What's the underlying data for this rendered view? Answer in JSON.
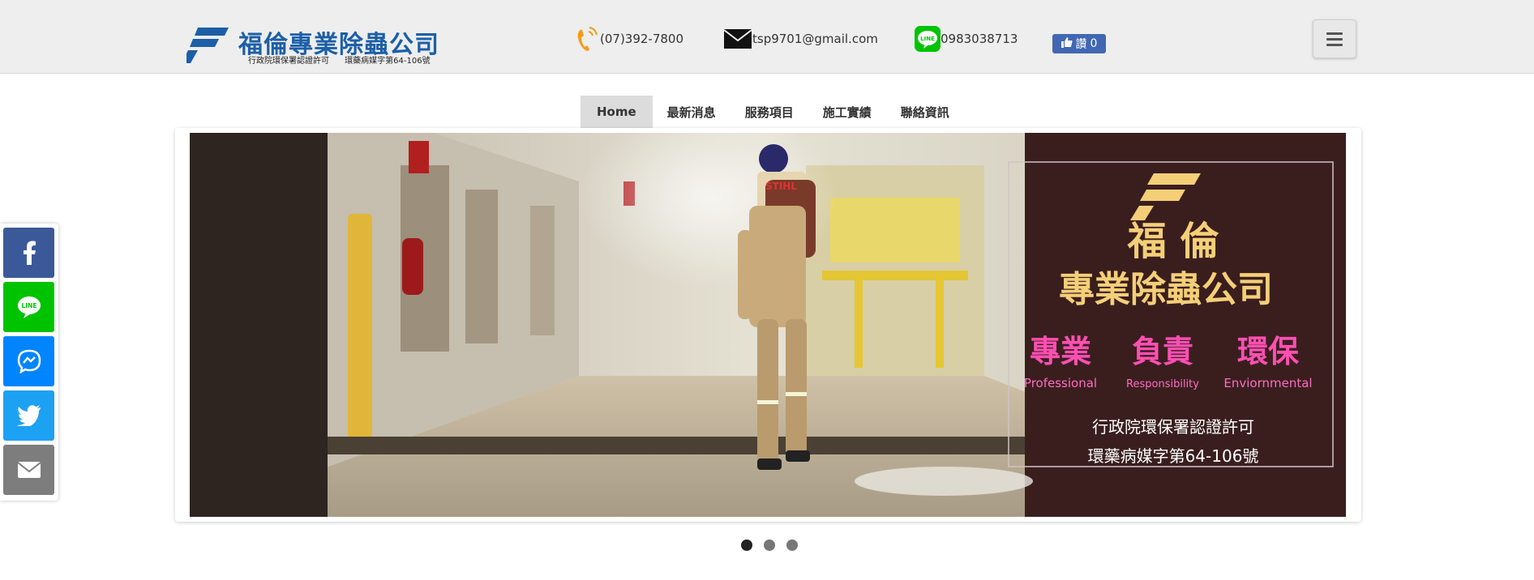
{
  "header": {
    "logo_title": "福倫專業除蟲公司",
    "logo_subtitle": "行政院環保署認證許可 環藥病媒字第64-106號",
    "phone": "(07)392-7800",
    "email": "tsp9701@gmail.com",
    "line_id": "0983038713",
    "fb_like_label": "讚",
    "fb_like_count": "0"
  },
  "nav": {
    "items": [
      "Home",
      "最新消息",
      "服務項目",
      "施工實績",
      "聯絡資訊"
    ],
    "active": "Home"
  },
  "slider": {
    "slide_brand_line1": "福 倫",
    "slide_brand_line2": "專業除蟲公司",
    "slide_values": [
      "專業",
      "負責",
      "環保"
    ],
    "slide_values_en": [
      "Professional",
      "Responsibility",
      "Enviornmental"
    ],
    "slide_cert_line1": "行政院環保署認證許可",
    "slide_cert_line2": "環藥病媒字第64-106號",
    "sprayer_brand": "STIHL",
    "dots_count": 3,
    "active_dot": 0
  },
  "share": {
    "buttons": [
      "facebook-icon",
      "line-icon",
      "messenger-icon",
      "twitter-icon",
      "email-icon"
    ]
  },
  "colors": {
    "header_bg": "#eeeeee",
    "logo_blue": "#1c5fa8",
    "facebook": "#3b5998",
    "line": "#00c300",
    "messenger": "#0084ff",
    "twitter": "#1da1f2",
    "email": "#7d7d7d",
    "slide_gold": "#f4cf78",
    "slide_pink": "#ff4fb2"
  }
}
